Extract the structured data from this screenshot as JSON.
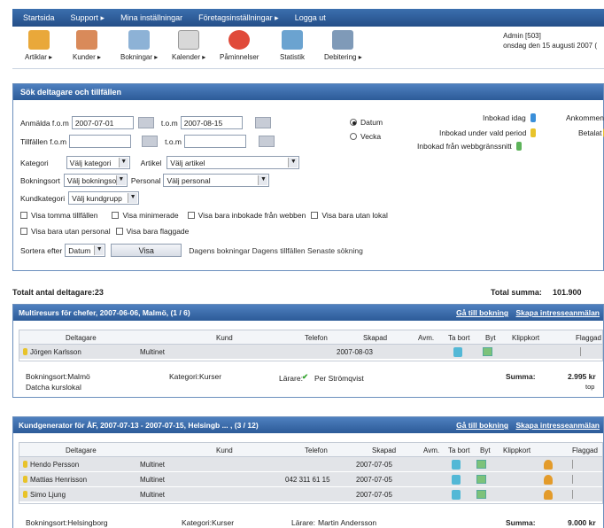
{
  "topnav": [
    "Startsida",
    "Support ▸",
    "Mina inställningar",
    "Företagsinställningar ▸",
    "Logga ut"
  ],
  "toolbar": [
    {
      "label": "Artiklar ▸",
      "icon": "box-icon",
      "color": "#e9a83a"
    },
    {
      "label": "Kunder ▸",
      "icon": "users-icon",
      "color": "#d98a5a"
    },
    {
      "label": "Bokningar ▸",
      "icon": "notepad-icon",
      "color": "#8db2d6"
    },
    {
      "label": "Kalender ▸",
      "icon": "calendar-icon",
      "color": "#d8d8d8"
    },
    {
      "label": "Påminnelser",
      "icon": "alarm-clock-icon",
      "color": "#e04a3a"
    },
    {
      "label": "Statistik",
      "icon": "chart-icon",
      "color": "#6ba3d0"
    },
    {
      "label": "Debitering ▸",
      "icon": "register-icon",
      "color": "#7f9ab8"
    }
  ],
  "admin": {
    "line1": "Admin [503]",
    "line2": "onsdag den 15 augusti 2007 ("
  },
  "search": {
    "title": "Sök deltagare och tillfällen",
    "anmalda_label": "Anmälda f.o.m",
    "anmalda_from": "2007-07-01",
    "tom_label": "t.o.m",
    "anmalda_to": "2007-08-15",
    "tillfallen_label": "Tillfällen f.o.m",
    "tillfallen_from": "",
    "tillfallen_to": "",
    "kategori_label": "Kategori",
    "kategori_value": "Välj kategori",
    "artikel_label": "Artikel",
    "artikel_value": "Välj artikel",
    "bokningsort_label": "Bokningsort",
    "bokningsort_value": "Välj bokningsort",
    "personal_label": "Personal",
    "personal_value": "Välj personal",
    "kundkategori_label": "Kundkategori",
    "kundkategori_value": "Välj kundgrupp",
    "radio_datum": "Datum",
    "radio_vecka": "Vecka",
    "legend": [
      "Inbokad idag",
      "Inbokad under vald period",
      "Inbokad från webbgränssnitt"
    ],
    "legend2": [
      "Ankommen",
      "Betalat"
    ],
    "checks": [
      "Visa tomma tillfällen",
      "Visa minimerade",
      "Visa bara inbokade från webben",
      "Visa bara utan lokal",
      "Visa bara utan personal",
      "Visa bara flaggade"
    ],
    "sort_label": "Sortera efter",
    "sort_value": "Datum",
    "visa_button": "Visa",
    "quicklinks": "Dagens bokningar  Dagens tillfällen  Senaste sökning"
  },
  "totals": {
    "left": "Totalt antal deltagare:23",
    "right_label": "Total summa:",
    "right_value": "101.900"
  },
  "block1": {
    "title": "Multiresurs för chefer, 2007-06-06, Malmö, (1 / 6)",
    "link1": "Gå till bokning",
    "link2": "Skapa intresseanmälan",
    "headers": [
      "Deltagare",
      "Kund",
      "Telefon",
      "Skapad",
      "Avm.",
      "Ta bort",
      "Byt",
      "Klippkort",
      "Flaggad"
    ],
    "rows": [
      {
        "name": "Jörgen Karlsson",
        "kund": "Multinet",
        "telefon": "",
        "skapad": "2007-08-03"
      }
    ],
    "ort": "Bokningsort:Malmö",
    "lokal": "Datcha kurslokal",
    "kategori": "Kategori:Kurser",
    "larare_label": "Lärare:",
    "larare": "Per Strömqvist",
    "summa_label": "Summa:",
    "summa": "2.995 kr",
    "top": "top"
  },
  "block2": {
    "title": "Kundgenerator för ÅF, 2007-07-13 - 2007-07-15, Helsingb ... , (3 / 12)",
    "link1": "Gå till bokning",
    "link2": "Skapa intresseanmälan",
    "headers": [
      "Deltagare",
      "Kund",
      "Telefon",
      "Skapad",
      "Avm.",
      "Ta bort",
      "Byt",
      "Klippkort",
      "Flaggad"
    ],
    "rows": [
      {
        "name": "Hendo Persson",
        "kund": "Multinet",
        "telefon": "",
        "skapad": "2007-07-05"
      },
      {
        "name": "Mattias Henrisson",
        "kund": "Multinet",
        "telefon": "042 311 61 15",
        "skapad": "2007-07-05"
      },
      {
        "name": "Simo Ljung",
        "kund": "Multinet",
        "telefon": "",
        "skapad": "2007-07-05"
      }
    ],
    "ort": "Bokningsort:Helsingborg",
    "kategori": "Kategori:Kurser",
    "larare_label": "Lärare:",
    "larare": "Martin Andersson",
    "summa_label": "Summa:",
    "summa": "9.000 kr"
  }
}
